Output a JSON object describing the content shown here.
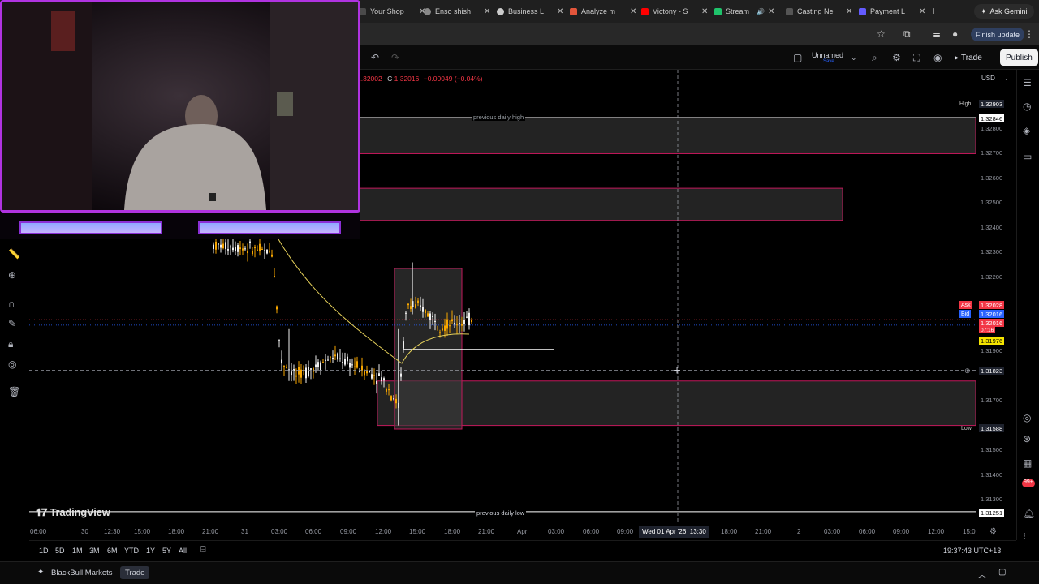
{
  "browser": {
    "tabs": [
      {
        "title": "Your Shop",
        "color": "#4a4a4a"
      },
      {
        "title": "Enso shish",
        "color": "#888888"
      },
      {
        "title": "Business L",
        "color": "#cccccc"
      },
      {
        "title": "Analyze m",
        "color": "#e2553b"
      },
      {
        "title": "Victony - S",
        "color": "#ff0000"
      },
      {
        "title": "Stream",
        "color": "#1fc36b"
      },
      {
        "title": "Casting Ne",
        "color": "#555555"
      },
      {
        "title": "Payment L",
        "color": "#635bff"
      }
    ],
    "new_tab": "+",
    "ask_gemini": "Ask Gemini",
    "finish_update": "Finish update"
  },
  "toolbar": {
    "layout_name": "Unnamed",
    "layout_sub": "Save",
    "trade_label": "Trade",
    "publish_label": "Publish"
  },
  "legend": {
    "ohlc_prefix": "1.32002",
    "close_label": "C",
    "close": "1.32016",
    "change": "−0.00049 (−0.04%)"
  },
  "price_scale": {
    "currency": "USD",
    "ticks": [
      "1.32800",
      "1.32700",
      "1.32600",
      "1.32500",
      "1.32400",
      "1.32300",
      "1.32200",
      "1.31900",
      "1.31700",
      "1.31500",
      "1.31400",
      "1.31300"
    ],
    "high_tag": "High",
    "high_value": "1.32903",
    "prev_high_value": "1.32846",
    "ask_tag": "Ask",
    "ask_value": "1.32028",
    "bid_tag": "Bid",
    "bid_value": "1.32016",
    "last_value": "1.32016",
    "countdown": "07:16",
    "yellow_value": "1.31976",
    "crosshair_value": "1.31823",
    "low_tag": "Low",
    "low_value": "1.31588",
    "prev_low_value": "1.31251"
  },
  "annotations": {
    "prev_high": "previous daily high",
    "prev_low": "previous daily low"
  },
  "time_axis": {
    "labels": [
      "06:00",
      "30",
      "12:30",
      "15:00",
      "18:00",
      "21:00",
      "31",
      "03:00",
      "06:00",
      "09:00",
      "12:00",
      "15:00",
      "18:00",
      "21:00",
      "Apr",
      "03:00",
      "06:00",
      "09:00",
      "18:00",
      "21:00",
      "2",
      "03:00",
      "06:00",
      "09:00",
      "12:00",
      "15:0"
    ],
    "cursor_date": "Wed 01 Apr '26",
    "cursor_time": "13:30"
  },
  "branding": {
    "logo": "TradingView"
  },
  "range_bar": {
    "ranges": [
      "1D",
      "5D",
      "1M",
      "3M",
      "6M",
      "YTD",
      "1Y",
      "5Y",
      "All"
    ],
    "clock": "19:37:43 UTC+13"
  },
  "broker_bar": {
    "name": "BlackBull Markets",
    "trade": "Trade"
  },
  "colors": {
    "bull": "#f7a600",
    "bear": "#f0f0f0",
    "zone_border": "#c2185b",
    "zone_fill": "#2f2f2f",
    "ask": "#f23645",
    "bid": "#2962ff",
    "webcam_border": "#b033e0"
  },
  "chart_data": {
    "type": "candlestick",
    "symbol_close": 1.32016,
    "price_levels": {
      "prev_day_high": 1.32846,
      "prev_day_low": 1.31251,
      "session_high": 1.32903,
      "session_low": 1.31588,
      "ask": 1.32028,
      "bid": 1.32016,
      "crosshair": 1.31823
    },
    "zones": [
      {
        "from": 1.32846,
        "to": 1.327
      },
      {
        "from": 1.3256,
        "to": 1.3243
      },
      {
        "from": 1.3178,
        "to": 1.316
      }
    ]
  }
}
